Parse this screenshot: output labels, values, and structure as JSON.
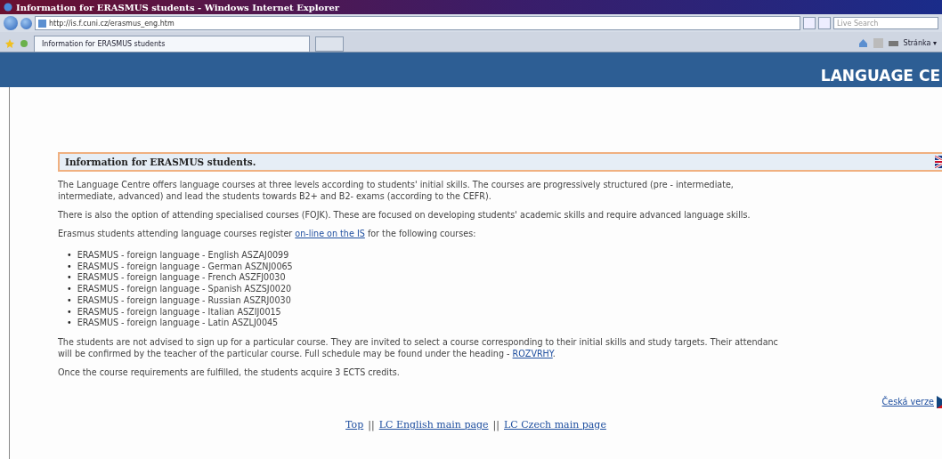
{
  "window": {
    "title": "Information for ERASMUS students - Windows Internet Explorer"
  },
  "address_bar": {
    "value": "http://is.f.cuni.cz/erasmus_eng.htm"
  },
  "search": {
    "placeholder": "Live Search"
  },
  "tabs": [
    {
      "label": "Information for ERASMUS students",
      "selected": true
    }
  ],
  "toolbar": {
    "page_menu": "Stránka ▾"
  },
  "header": {
    "title": "LANGUAGE CE"
  },
  "content": {
    "heading": "Information for ERASMUS students.",
    "paragraphs": [
      "The Language Centre offers language courses at three levels according to students' initial skills. The courses are progressively structured (pre - intermediate,\nintermediate, advanced) and lead the students towards B2+ and B2- exams (according to the CEFR).",
      "There is also the option of attending specialised courses (FOJK). These are focused on developing students' academic skills and require advanced language skills."
    ],
    "register": {
      "before": "Erasmus students attending language courses register ",
      "link": "on-line on the IS",
      "after": " for the following courses:"
    },
    "course_marker": "•",
    "courses": [
      "ERASMUS - foreign language - English ASZAJ0099",
      "ERASMUS - foreign language - German ASZNJ0065",
      "ERASMUS - foreign language - French ASZFJ0030",
      "ERASMUS - foreign language - Spanish ASZSJ0020",
      "ERASMUS - foreign language - Russian ASZRJ0030",
      "ERASMUS - foreign language - Italian ASZIJ0015",
      "ERASMUS - foreign language - Latin ASZLJ0045"
    ],
    "advice": {
      "before": "The students are not advised to sign up for a particular course. They are invited to select a course corresponding to their initial skills and study targets. Their attendanc\nwill be confirmed by the teacher of the particular course. Full schedule may be found under the heading - ",
      "link": "ROZVRHY",
      "after": "."
    },
    "credits": "Once the course requirements are fulfilled, the students acquire 3 ECTS credits.",
    "czech_link": "Česká verze"
  },
  "footer": [
    {
      "kind": "link",
      "text": "Top"
    },
    {
      "kind": "sep",
      "text": "||"
    },
    {
      "kind": "link",
      "text": "LC English main page"
    },
    {
      "kind": "sep",
      "text": "||"
    },
    {
      "kind": "link",
      "text": "LC Czech main page"
    }
  ]
}
